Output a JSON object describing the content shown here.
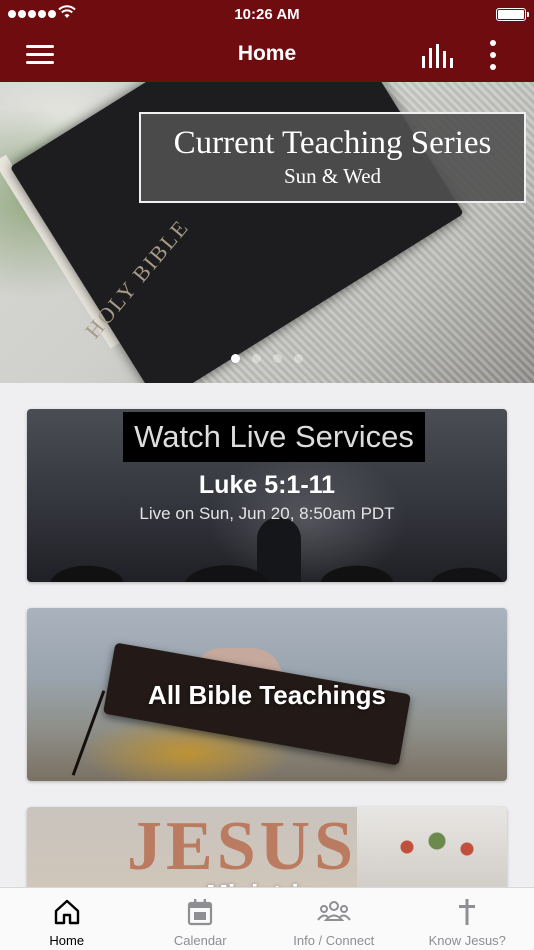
{
  "status_bar": {
    "time": "10:26 AM"
  },
  "nav": {
    "title": "Home"
  },
  "hero": {
    "caption_title": "Current Teaching Series",
    "caption_subtitle": "Sun & Wed",
    "book_text": "HOLY BIBLE",
    "slide_count": 4,
    "active_slide": 1
  },
  "cards": {
    "live": {
      "title": "Watch Live Services",
      "passage": "Luke 5:1-11",
      "schedule": "Live on Sun, Jun 20, 8:50am PDT"
    },
    "teachings": {
      "title": "All Bible Teachings"
    },
    "ministries": {
      "title": "Ministries"
    }
  },
  "tabs": [
    {
      "label": "Home",
      "icon": "home-icon",
      "active": true
    },
    {
      "label": "Calendar",
      "icon": "calendar-icon",
      "active": false
    },
    {
      "label": "Info / Connect",
      "icon": "people-icon",
      "active": false
    },
    {
      "label": "Know Jesus?",
      "icon": "cross-icon",
      "active": false
    }
  ],
  "colors": {
    "brand": "#6e0c10",
    "tab_active": "#000000",
    "tab_inactive": "#8e8e93"
  }
}
